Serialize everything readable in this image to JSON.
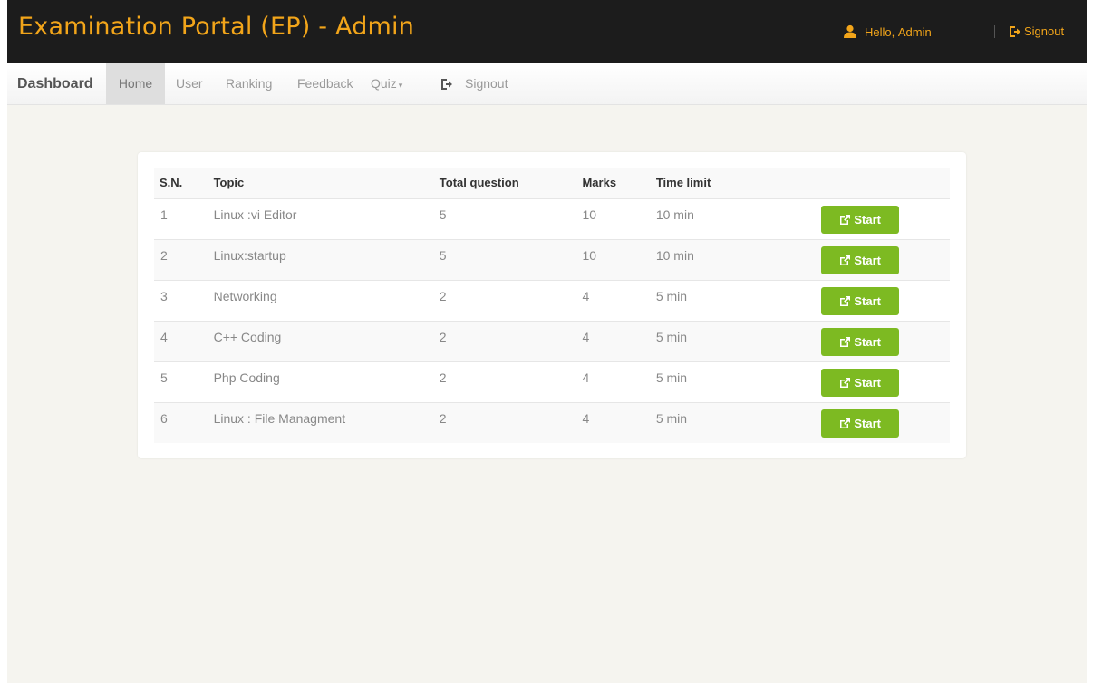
{
  "header": {
    "title": "Examination Portal (EP) - Admin",
    "greeting": "Hello,",
    "username": "Admin",
    "signout_label": "Signout"
  },
  "navbar": {
    "brand": "Dashboard",
    "items": [
      {
        "label": "Home",
        "active": true
      },
      {
        "label": "User"
      },
      {
        "label": "Ranking"
      },
      {
        "label": "Feedback"
      },
      {
        "label": "Quiz"
      },
      {
        "label": "Signout"
      }
    ]
  },
  "quiz_table": {
    "columns": [
      "S.N.",
      "Topic",
      "Total question",
      "Marks",
      "Time limit",
      ""
    ],
    "rows": [
      {
        "sn": "1",
        "topic": "Linux :vi Editor",
        "total": "5",
        "marks": "10",
        "time": "10 min",
        "action": "Start"
      },
      {
        "sn": "2",
        "topic": "Linux:startup",
        "total": "5",
        "marks": "10",
        "time": "10 min",
        "action": "Start"
      },
      {
        "sn": "3",
        "topic": "Networking",
        "total": "2",
        "marks": "4",
        "time": "5 min",
        "action": "Start"
      },
      {
        "sn": "4",
        "topic": "C++ Coding",
        "total": "2",
        "marks": "4",
        "time": "5 min",
        "action": "Start"
      },
      {
        "sn": "5",
        "topic": "Php Coding",
        "total": "2",
        "marks": "4",
        "time": "5 min",
        "action": "Start"
      },
      {
        "sn": "6",
        "topic": "Linux : File Managment",
        "total": "2",
        "marks": "4",
        "time": "5 min",
        "action": "Start"
      }
    ]
  },
  "colors": {
    "header_bg": "#1c1c1c",
    "accent_orange": "#f2a51a",
    "start_green": "#7dba22",
    "page_bg": "#f5f4ef"
  },
  "icons": {
    "user": "user-icon",
    "signout": "log-out-icon",
    "start": "share-square-icon"
  }
}
